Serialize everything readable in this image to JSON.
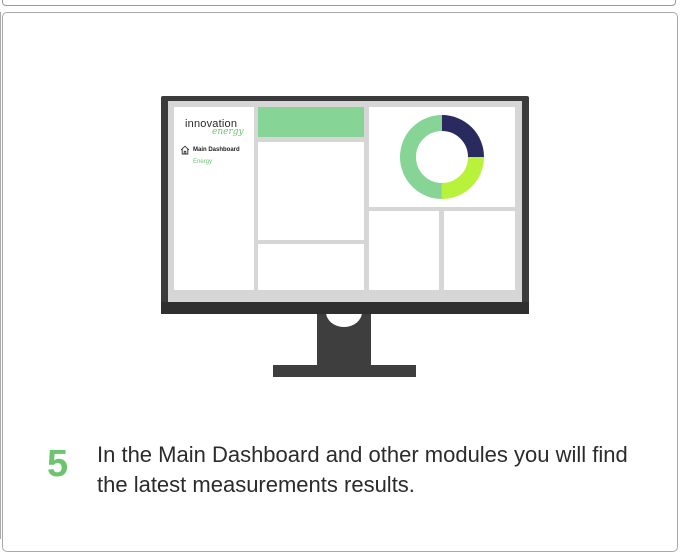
{
  "app": {
    "logo_main": "innovation",
    "logo_sub": "energy",
    "nav": {
      "item_label": "Main Dashboard",
      "sub_label": "Energy"
    }
  },
  "donut": {
    "segments": [
      {
        "share": 0.25,
        "color": "#2b2a5f"
      },
      {
        "share": 0.25,
        "color": "#b9f23a"
      },
      {
        "share": 0.5,
        "color": "#86d496"
      }
    ]
  },
  "step": {
    "number": "5",
    "text": "In the Main Dashboard and other modules you will find the latest measurements results."
  },
  "colors": {
    "accent_green": "#6cc46e",
    "bar_green": "#86d496",
    "navy": "#2b2a5f",
    "lime": "#b9f23a"
  }
}
